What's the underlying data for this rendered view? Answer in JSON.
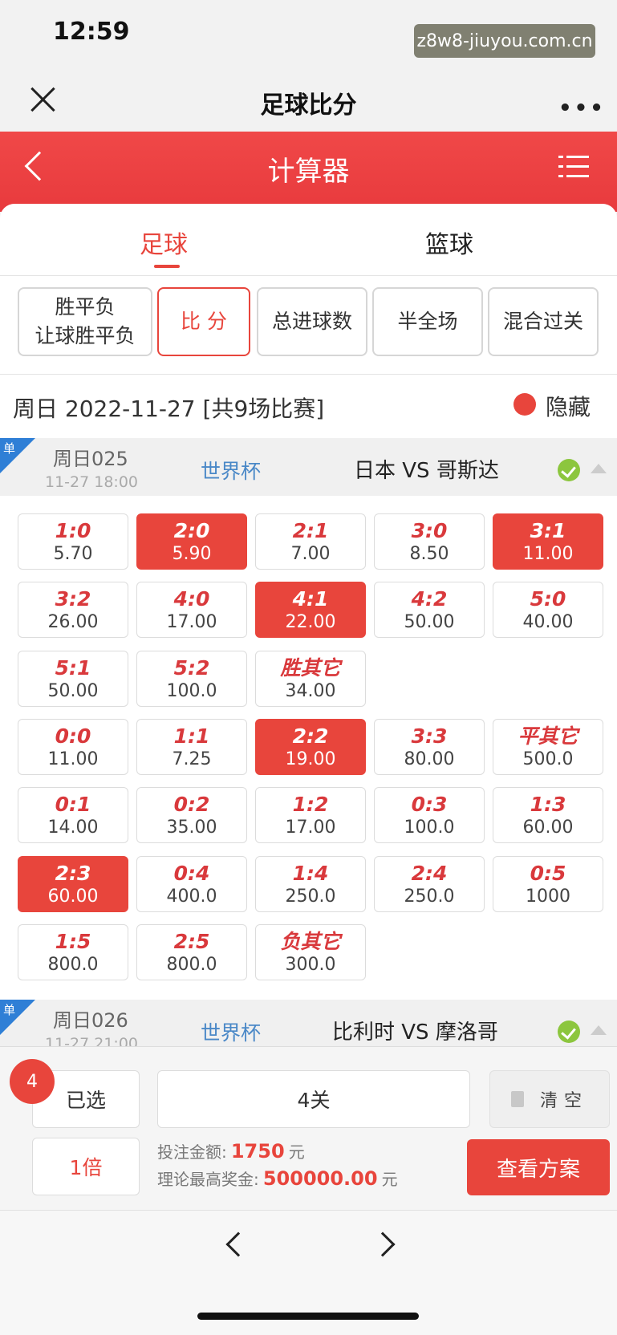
{
  "status_bar": {
    "time": "12:59",
    "watermark": "z8w8-jiuyou.com.cn"
  },
  "nav": {
    "title": "足球比分",
    "more": "•••"
  },
  "header": {
    "title": "计算器"
  },
  "sport_tabs": [
    "足球",
    "篮球"
  ],
  "bet_types": [
    {
      "line1": "胜平负",
      "line2": "让球胜平负"
    },
    {
      "line1": "比 分"
    },
    {
      "line1": "总进球数"
    },
    {
      "line1": "半全场"
    },
    {
      "line1": "混合过关"
    }
  ],
  "date_row": {
    "text": "周日 2022-11-27 [共9场比赛]",
    "hide_label": "隐藏"
  },
  "matches": [
    {
      "badge": "单",
      "no": "周日025",
      "time": "11-27 18:00",
      "league": "世界杯",
      "teams": "日本 VS 哥斯达"
    },
    {
      "badge": "单",
      "no": "周日026",
      "time": "11-27 21:00",
      "league": "世界杯",
      "teams": "比利时 VS 摩洛哥"
    }
  ],
  "score_grid": [
    [
      {
        "s": "1:0",
        "o": "5.70",
        "sel": false
      },
      {
        "s": "2:0",
        "o": "5.90",
        "sel": true
      },
      {
        "s": "2:1",
        "o": "7.00",
        "sel": false
      },
      {
        "s": "3:0",
        "o": "8.50",
        "sel": false
      },
      {
        "s": "3:1",
        "o": "11.00",
        "sel": true
      }
    ],
    [
      {
        "s": "3:2",
        "o": "26.00",
        "sel": false
      },
      {
        "s": "4:0",
        "o": "17.00",
        "sel": false
      },
      {
        "s": "4:1",
        "o": "22.00",
        "sel": true
      },
      {
        "s": "4:2",
        "o": "50.00",
        "sel": false
      },
      {
        "s": "5:0",
        "o": "40.00",
        "sel": false
      }
    ],
    [
      {
        "s": "5:1",
        "o": "50.00",
        "sel": false
      },
      {
        "s": "5:2",
        "o": "100.0",
        "sel": false
      },
      {
        "s": "胜其它",
        "o": "34.00",
        "sel": false
      }
    ],
    [
      {
        "s": "0:0",
        "o": "11.00",
        "sel": false
      },
      {
        "s": "1:1",
        "o": "7.25",
        "sel": false
      },
      {
        "s": "2:2",
        "o": "19.00",
        "sel": true
      },
      {
        "s": "3:3",
        "o": "80.00",
        "sel": false
      },
      {
        "s": "平其它",
        "o": "500.0",
        "sel": false
      }
    ],
    [
      {
        "s": "0:1",
        "o": "14.00",
        "sel": false
      },
      {
        "s": "0:2",
        "o": "35.00",
        "sel": false
      },
      {
        "s": "1:2",
        "o": "17.00",
        "sel": false
      },
      {
        "s": "0:3",
        "o": "100.0",
        "sel": false
      },
      {
        "s": "1:3",
        "o": "60.00",
        "sel": false
      }
    ],
    [
      {
        "s": "2:3",
        "o": "60.00",
        "sel": true
      },
      {
        "s": "0:4",
        "o": "400.0",
        "sel": false
      },
      {
        "s": "1:4",
        "o": "250.0",
        "sel": false
      },
      {
        "s": "2:4",
        "o": "250.0",
        "sel": false
      },
      {
        "s": "0:5",
        "o": "1000",
        "sel": false
      }
    ],
    [
      {
        "s": "1:5",
        "o": "800.0",
        "sel": false
      },
      {
        "s": "2:5",
        "o": "800.0",
        "sel": false
      },
      {
        "s": "负其它",
        "o": "300.0",
        "sel": false
      }
    ]
  ],
  "bottom": {
    "selected_count": "4",
    "selected_label": "已选",
    "pass_type": "4关",
    "clear_label": "清空",
    "multiplier": "1倍",
    "bet_amount_label": "投注金额:",
    "bet_amount": "1750",
    "bet_amount_unit": "元",
    "max_prize_label": "理论最高奖金:",
    "max_prize": "500000.00",
    "max_prize_unit": "元",
    "view_plan": "查看方案"
  },
  "colors": {
    "accent": "#e8453c",
    "league": "#4a88c7",
    "check": "#8cc63e",
    "badge": "#2f7fd6"
  }
}
